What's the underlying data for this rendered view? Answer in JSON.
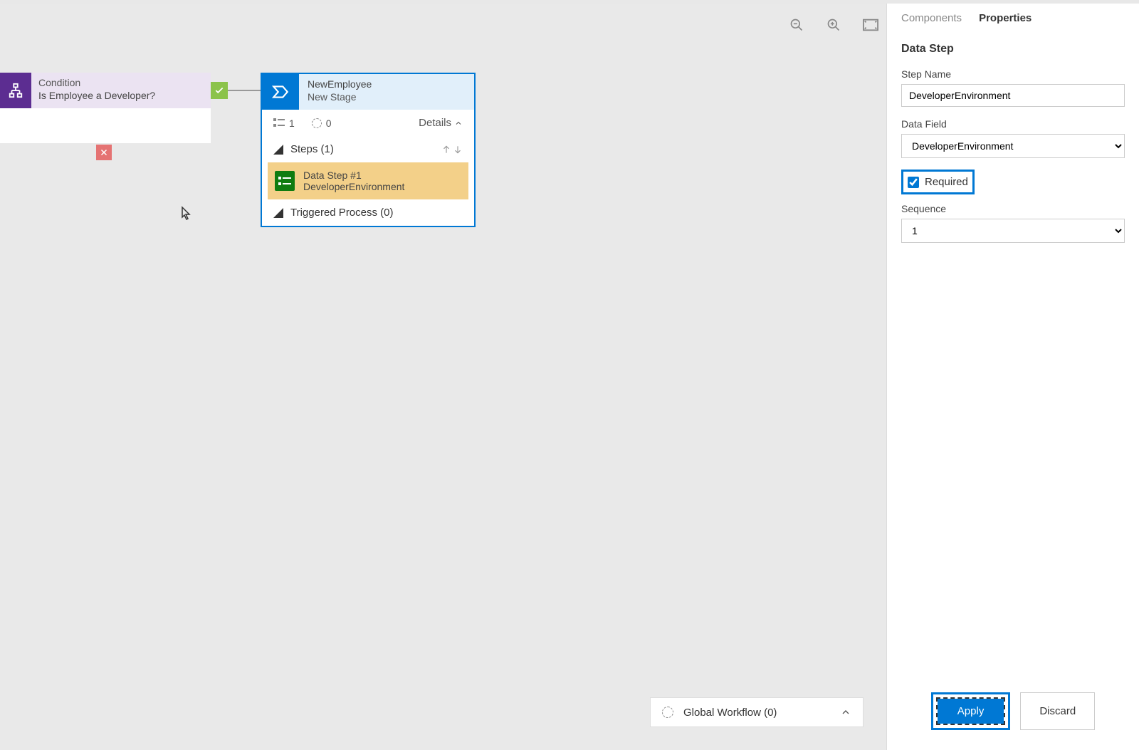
{
  "toolbar": {
    "zoom_out": "zoom-out",
    "zoom_in": "zoom-in",
    "fit_screen": "fit-screen"
  },
  "condition": {
    "label": "Condition",
    "question": "Is Employee a Developer?"
  },
  "stage": {
    "title": "NewEmployee",
    "subtitle": "New Stage",
    "count1": "1",
    "count2": "0",
    "details_label": "Details",
    "steps_label": "Steps (1)",
    "data_step_title": "Data Step #1",
    "data_step_name": "DeveloperEnvironment",
    "triggered_label": "Triggered Process (0)"
  },
  "global_workflow": {
    "label": "Global Workflow (0)"
  },
  "panel": {
    "tab_components": "Components",
    "tab_properties": "Properties",
    "title": "Data Step",
    "step_name_label": "Step Name",
    "step_name_value": "DeveloperEnvironment",
    "data_field_label": "Data Field",
    "data_field_value": "DeveloperEnvironment",
    "required_label": "Required",
    "sequence_label": "Sequence",
    "sequence_value": "1",
    "apply_label": "Apply",
    "discard_label": "Discard"
  }
}
